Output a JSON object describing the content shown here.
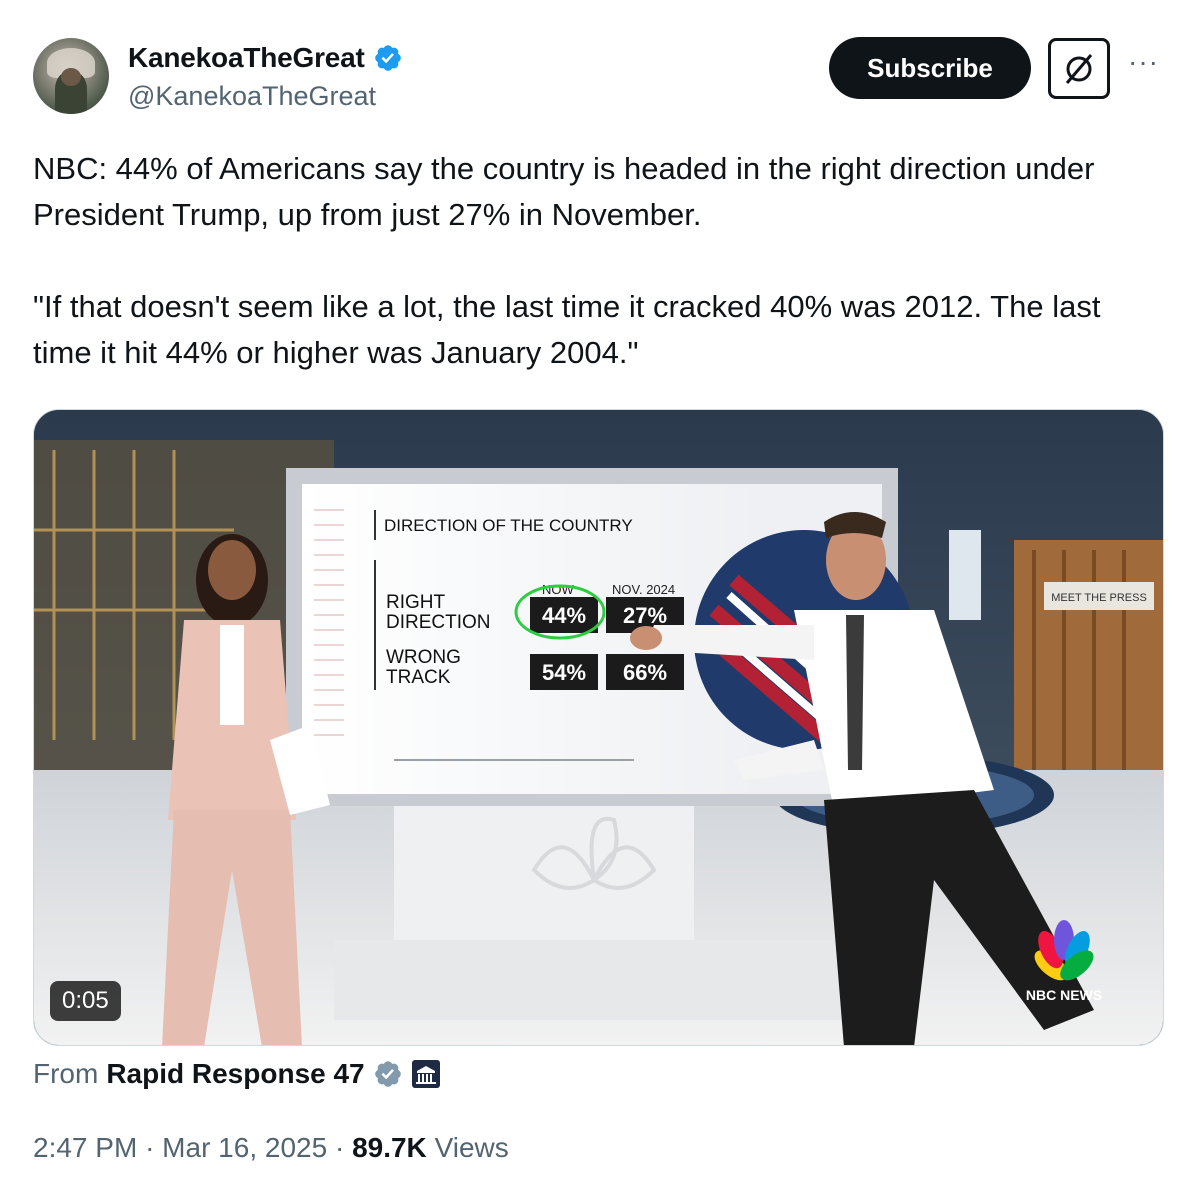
{
  "user": {
    "display_name": "KanekoaTheGreat",
    "handle": "@KanekoaTheGreat"
  },
  "actions": {
    "subscribe_label": "Subscribe",
    "more_label": "···"
  },
  "tweet": {
    "paragraph1": "NBC: 44% of Americans say the country is headed in the right direction under President Trump, up from just 27% in November.",
    "paragraph2": "\"If that doesn't seem like a lot, the last time it cracked 40% was 2012. The last time it hit 44% or higher was January 2004.\""
  },
  "video": {
    "duration": "0:05",
    "board": {
      "title": "DIRECTION OF THE COUNTRY",
      "col_now": "NOW",
      "col_prev": "NOV. 2024",
      "row1_label_a": "RIGHT",
      "row1_label_b": "DIRECTION",
      "row2_label_a": "WRONG",
      "row2_label_b": "TRACK",
      "right_now": "44%",
      "right_prev": "27%",
      "wrong_now": "54%",
      "wrong_prev": "66%"
    },
    "studio_sign": "MEET THE PRESS",
    "network_logo": "NBC NEWS"
  },
  "source": {
    "prefix": "From",
    "name": "Rapid Response 47"
  },
  "meta": {
    "time": "2:47 PM",
    "separator": "·",
    "date": "Mar 16, 2025",
    "views_count": "89.7K",
    "views_label": "Views"
  },
  "colors": {
    "verified_blue": "#1d9bf0",
    "text_primary": "#0f1419",
    "text_secondary": "#536471"
  }
}
